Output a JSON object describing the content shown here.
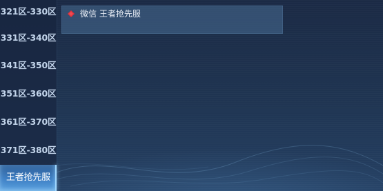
{
  "sidebar": {
    "items": [
      {
        "label": "321区-330区"
      },
      {
        "label": "331区-340区"
      },
      {
        "label": "341区-350区"
      },
      {
        "label": "351区-360区"
      },
      {
        "label": "361区-370区"
      },
      {
        "label": "371区-380区"
      },
      {
        "label": "王者抢先服",
        "selected": true
      }
    ]
  },
  "server_list": {
    "items": [
      {
        "label": "微信 王者抢先服",
        "status_icon": "red-diamond-status-icon",
        "status_color": "#e0313b"
      }
    ]
  },
  "colors": {
    "selected_tab": "#3f80c5",
    "sidebar_text": "#c2d4ea",
    "status_red": "#e0313b",
    "background": "#1f3451"
  }
}
